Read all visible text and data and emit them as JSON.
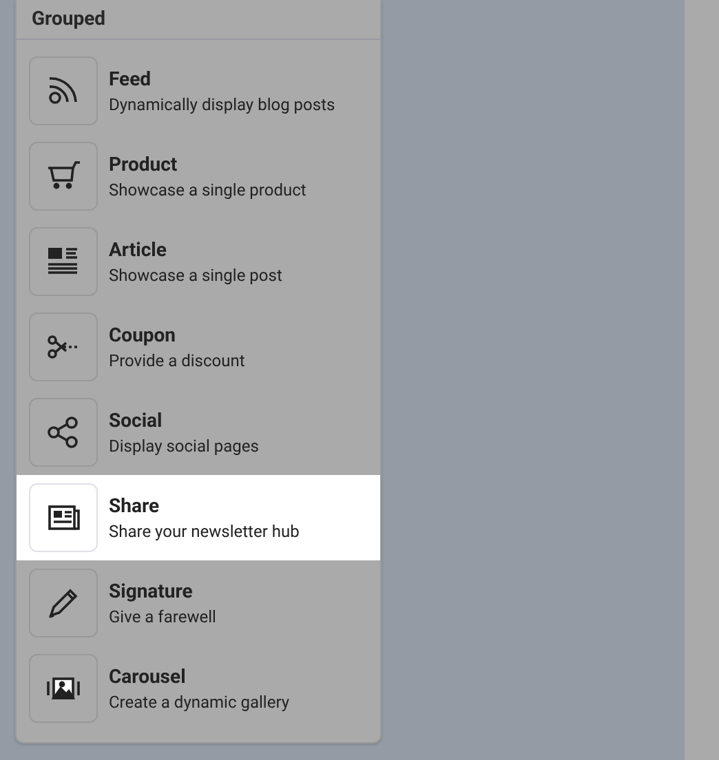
{
  "panel": {
    "title": "Grouped",
    "items": [
      {
        "title": "Feed",
        "description": "Dynamically display blog posts",
        "selected": false
      },
      {
        "title": "Product",
        "description": "Showcase a single product",
        "selected": false
      },
      {
        "title": "Article",
        "description": "Showcase a single post",
        "selected": false
      },
      {
        "title": "Coupon",
        "description": "Provide a discount",
        "selected": false
      },
      {
        "title": "Social",
        "description": "Display social pages",
        "selected": false
      },
      {
        "title": "Share",
        "description": "Share your newsletter hub",
        "selected": true
      },
      {
        "title": "Signature",
        "description": "Give a farewell",
        "selected": false
      },
      {
        "title": "Carousel",
        "description": "Create a dynamic gallery",
        "selected": false
      }
    ]
  }
}
